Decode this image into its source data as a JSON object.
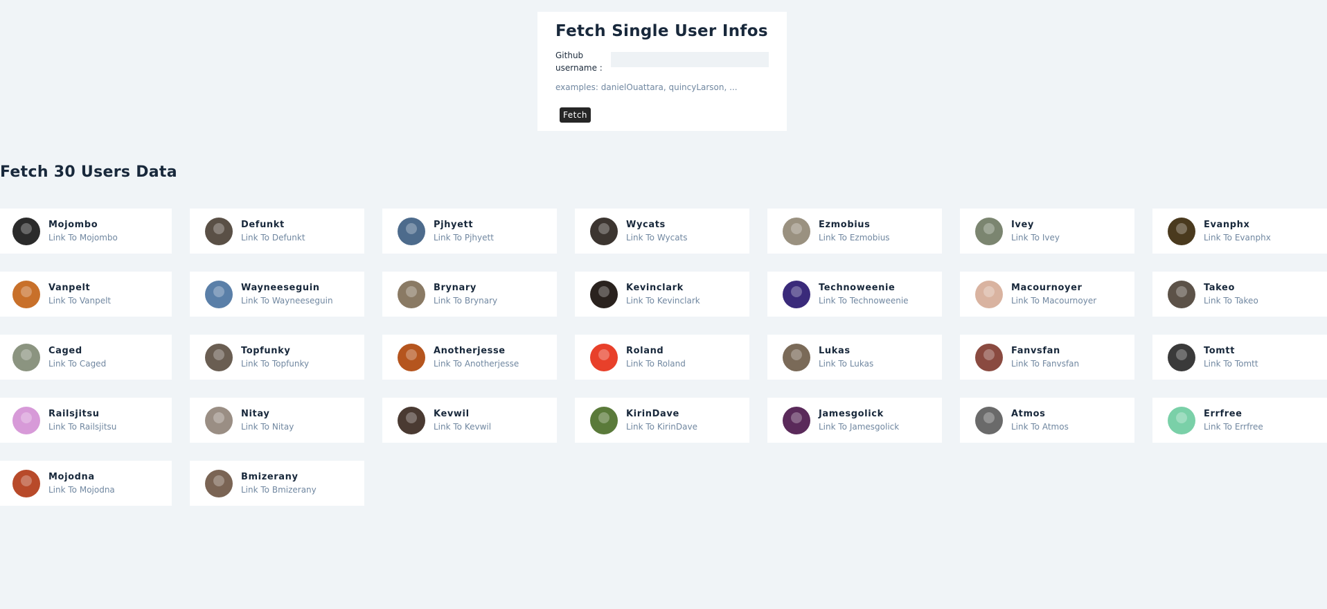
{
  "single": {
    "title": "Fetch Single User Infos",
    "label": "Github username :",
    "input_value": "",
    "examples": "examples: danielOuattara, quincyLarson, ...",
    "button_label": "Fetch"
  },
  "section_title": "Fetch 30 Users Data",
  "users": [
    {
      "name": "Mojombo",
      "link": "Link To Mojombo",
      "avatar_color": "#2b2b2b"
    },
    {
      "name": "Defunkt",
      "link": "Link To Defunkt",
      "avatar_color": "#5a5046"
    },
    {
      "name": "Pjhyett",
      "link": "Link To Pjhyett",
      "avatar_color": "#4d6b8c"
    },
    {
      "name": "Wycats",
      "link": "Link To Wycats",
      "avatar_color": "#3c3530"
    },
    {
      "name": "Ezmobius",
      "link": "Link To Ezmobius",
      "avatar_color": "#9a9180"
    },
    {
      "name": "Ivey",
      "link": "Link To Ivey",
      "avatar_color": "#7b8570"
    },
    {
      "name": "Evanphx",
      "link": "Link To Evanphx",
      "avatar_color": "#4a3a1e"
    },
    {
      "name": "Vanpelt",
      "link": "Link To Vanpelt",
      "avatar_color": "#c8702a"
    },
    {
      "name": "Wayneeseguin",
      "link": "Link To Wayneeseguin",
      "avatar_color": "#5a7fa8"
    },
    {
      "name": "Brynary",
      "link": "Link To Brynary",
      "avatar_color": "#8a7a64"
    },
    {
      "name": "Kevinclark",
      "link": "Link To Kevinclark",
      "avatar_color": "#2a221e"
    },
    {
      "name": "Technoweenie",
      "link": "Link To Technoweenie",
      "avatar_color": "#3a2a7a"
    },
    {
      "name": "Macournoyer",
      "link": "Link To Macournoyer",
      "avatar_color": "#d9b3a0"
    },
    {
      "name": "Takeo",
      "link": "Link To Takeo",
      "avatar_color": "#5c5248"
    },
    {
      "name": "Caged",
      "link": "Link To Caged",
      "avatar_color": "#8b9480"
    },
    {
      "name": "Topfunky",
      "link": "Link To Topfunky",
      "avatar_color": "#6a5e52"
    },
    {
      "name": "Anotherjesse",
      "link": "Link To Anotherjesse",
      "avatar_color": "#b5551e"
    },
    {
      "name": "Roland",
      "link": "Link To Roland",
      "avatar_color": "#e8402a"
    },
    {
      "name": "Lukas",
      "link": "Link To Lukas",
      "avatar_color": "#7a6a58"
    },
    {
      "name": "Fanvsfan",
      "link": "Link To Fanvsfan",
      "avatar_color": "#8a4a40"
    },
    {
      "name": "Tomtt",
      "link": "Link To Tomtt",
      "avatar_color": "#3a3a3a"
    },
    {
      "name": "Railsjitsu",
      "link": "Link To Railsjitsu",
      "avatar_color": "#d79ad8"
    },
    {
      "name": "Nitay",
      "link": "Link To Nitay",
      "avatar_color": "#9a8e84"
    },
    {
      "name": "Kevwil",
      "link": "Link To Kevwil",
      "avatar_color": "#4a3a32"
    },
    {
      "name": "KirinDave",
      "link": "Link To KirinDave",
      "avatar_color": "#5a7a3a"
    },
    {
      "name": "Jamesgolick",
      "link": "Link To Jamesgolick",
      "avatar_color": "#5a2a5a"
    },
    {
      "name": "Atmos",
      "link": "Link To Atmos",
      "avatar_color": "#6a6a6a"
    },
    {
      "name": "Errfree",
      "link": "Link To Errfree",
      "avatar_color": "#7ad0a8"
    },
    {
      "name": "Mojodna",
      "link": "Link To Mojodna",
      "avatar_color": "#b84a2a"
    },
    {
      "name": "Bmizerany",
      "link": "Link To Bmizerany",
      "avatar_color": "#7a6454"
    }
  ]
}
